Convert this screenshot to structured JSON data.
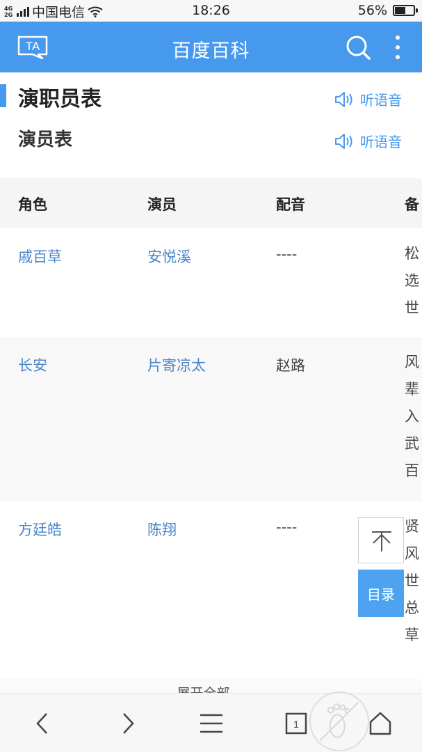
{
  "status_bar": {
    "network_top": "4G",
    "network_bottom": "2G",
    "carrier": "中国电信",
    "time": "18:26",
    "battery": "56%",
    "battery_level": 0.56
  },
  "header": {
    "title": "百度百科",
    "left_icon_text": "TA",
    "icons": [
      "ta-icon",
      "search-icon",
      "more-icon"
    ]
  },
  "section": {
    "title": "演职员表",
    "subtitle": "演员表",
    "listen_label": "听语音"
  },
  "table": {
    "headers": [
      "角色",
      "演员",
      "配音",
      "备"
    ],
    "rows": [
      {
        "role": "戚百草",
        "actor": "安悦溪",
        "voice": "----",
        "note": [
          "松",
          "选",
          "世"
        ]
      },
      {
        "role": "长安",
        "actor": "片寄凉太",
        "voice": "赵路",
        "note": [
          "风",
          "辈",
          "入",
          "武",
          "百"
        ]
      },
      {
        "role": "方廷皓",
        "actor": "陈翔",
        "voice": "----",
        "note": [
          "贤",
          "风",
          "世",
          "总",
          "草"
        ]
      }
    ]
  },
  "floating": {
    "toc_label": "目录",
    "top_icon": "arrow-up-to-top-icon"
  },
  "expand_label": "展开全部",
  "bottom_nav": {
    "tab_count": "1",
    "icons": [
      "back-icon",
      "forward-icon",
      "menu-icon",
      "tabs-icon",
      "home-icon"
    ]
  },
  "colors": {
    "brand_blue": "#4799ee",
    "link_blue": "#4a86c8",
    "toc_blue": "#4da3f0"
  }
}
